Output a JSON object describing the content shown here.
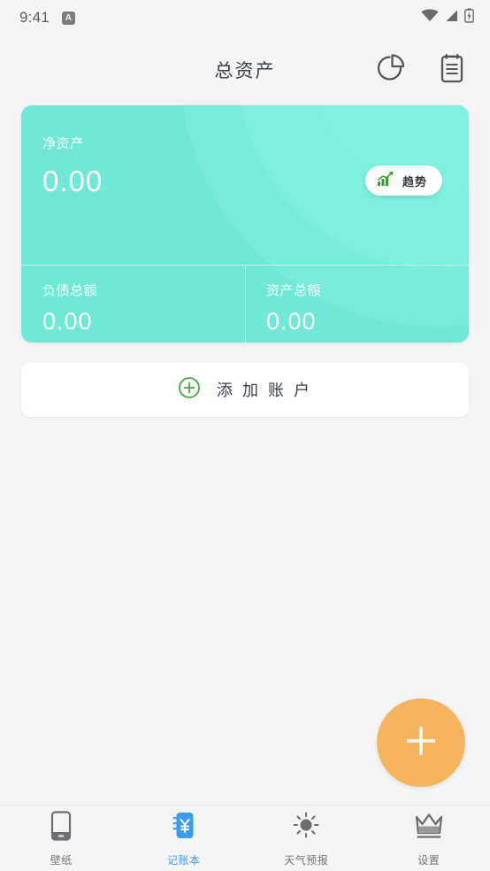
{
  "status_bar": {
    "time": "9:41",
    "app_badge": "A",
    "icons": [
      "wifi-icon",
      "cellular-signal-icon",
      "battery-charging-icon"
    ]
  },
  "header": {
    "title": "总资产",
    "actions": [
      {
        "name": "pie-chart-icon",
        "label": "pie-chart-icon"
      },
      {
        "name": "clipboard-icon",
        "label": "clipboard-icon"
      }
    ]
  },
  "summary_card": {
    "net_assets": {
      "label": "净资产",
      "value": "0.00"
    },
    "trend_button": {
      "label": "趋势",
      "icon": "trend-up-chart-icon"
    },
    "liabilities": {
      "label": "负债总额",
      "value": "0.00"
    },
    "assets": {
      "label": "资产总额",
      "value": "0.00"
    }
  },
  "add_account": {
    "label": "添 加 账 户",
    "icon": "plus-circle-icon"
  },
  "fab": {
    "icon": "plus-icon",
    "label": "添加"
  },
  "bottom_nav": {
    "items": [
      {
        "label": "壁纸",
        "icon": "phone-wallpaper-icon",
        "active": false
      },
      {
        "label": "记账本",
        "icon": "ledger-book-icon",
        "active": true
      },
      {
        "label": "天气预报",
        "icon": "sun-weather-icon",
        "active": false
      },
      {
        "label": "设置",
        "icon": "crown-settings-icon",
        "active": false
      }
    ]
  },
  "colors": {
    "background": "#f4f4f4",
    "card_teal": "#6fe9d6",
    "accent_orange": "#f7b45f",
    "active_blue": "#3d9bf5",
    "plus_green": "#43a83a",
    "text_dark": "#3a3f4b"
  }
}
